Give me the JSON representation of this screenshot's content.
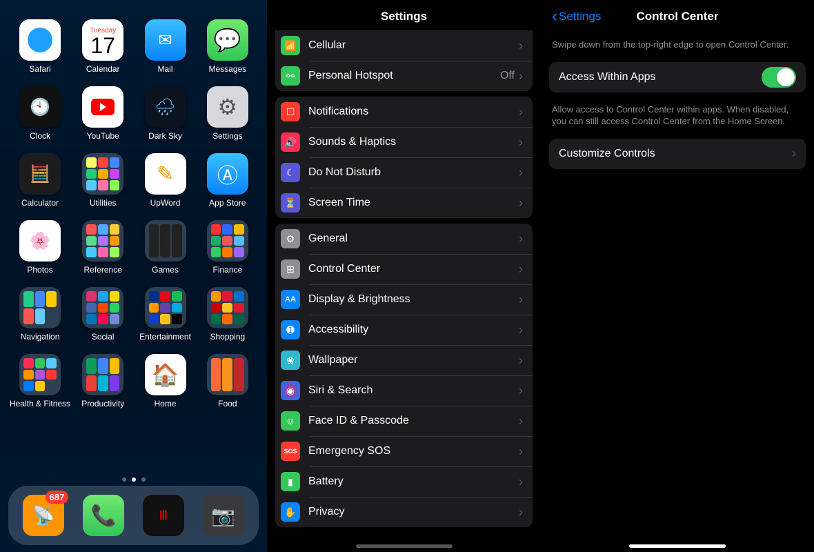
{
  "home": {
    "calendar": {
      "weekday": "Tuesday",
      "day": "17"
    },
    "apps_r1": [
      "Safari",
      "Calendar",
      "Mail",
      "Messages"
    ],
    "apps_r2": [
      "Clock",
      "YouTube",
      "Dark Sky",
      "Settings"
    ],
    "apps_r3": [
      "Calculator",
      "Utilities",
      "UpWord",
      "App Store"
    ],
    "apps_r4": [
      "Photos",
      "Reference",
      "Games",
      "Finance"
    ],
    "apps_r5": [
      "Navigation",
      "Social",
      "Entertainment",
      "Shopping"
    ],
    "apps_r6": [
      "Health & Fitness",
      "Productivity",
      "Home",
      "Food"
    ],
    "dock_badge": "687"
  },
  "settings": {
    "title": "Settings",
    "group_top": [
      {
        "label": "Cellular",
        "color": "#34c759",
        "glyph": ""
      },
      {
        "label": "Personal Hotspot",
        "color": "#34c759",
        "value": "Off",
        "glyph": ""
      }
    ],
    "group_notif": [
      {
        "label": "Notifications",
        "color": "#ff3b30",
        "glyph": ""
      },
      {
        "label": "Sounds & Haptics",
        "color": "#ff2d55",
        "glyph": ""
      },
      {
        "label": "Do Not Disturb",
        "color": "#5856d6",
        "glyph": ""
      },
      {
        "label": "Screen Time",
        "color": "#5856d6",
        "glyph": ""
      }
    ],
    "group_gen": [
      {
        "label": "General",
        "color": "#8e8e93",
        "glyph": ""
      },
      {
        "label": "Control Center",
        "color": "#8e8e93",
        "glyph": ""
      },
      {
        "label": "Display & Brightness",
        "color": "#0a84ff",
        "glyph": ""
      },
      {
        "label": "Accessibility",
        "color": "#0a84ff",
        "glyph": ""
      },
      {
        "label": "Wallpaper",
        "color": "#33b7cc",
        "glyph": ""
      },
      {
        "label": "Siri & Search",
        "color": "#222",
        "glyph": ""
      },
      {
        "label": "Face ID & Passcode",
        "color": "#34c759",
        "glyph": ""
      },
      {
        "label": "Emergency SOS",
        "color": "#ff3b30",
        "glyph": "SOS"
      },
      {
        "label": "Battery",
        "color": "#34c759",
        "glyph": ""
      },
      {
        "label": "Privacy",
        "color": "#0a84ff",
        "glyph": ""
      }
    ]
  },
  "cc": {
    "back": "Settings",
    "title": "Control Center",
    "swipe_caption": "Swipe down from the top-right edge to open Control Center.",
    "toggle_label": "Access Within Apps",
    "toggle_on": true,
    "toggle_caption": "Allow access to Control Center within apps. When disabled, you can still access Control Center from the Home Screen.",
    "customize": "Customize Controls"
  }
}
